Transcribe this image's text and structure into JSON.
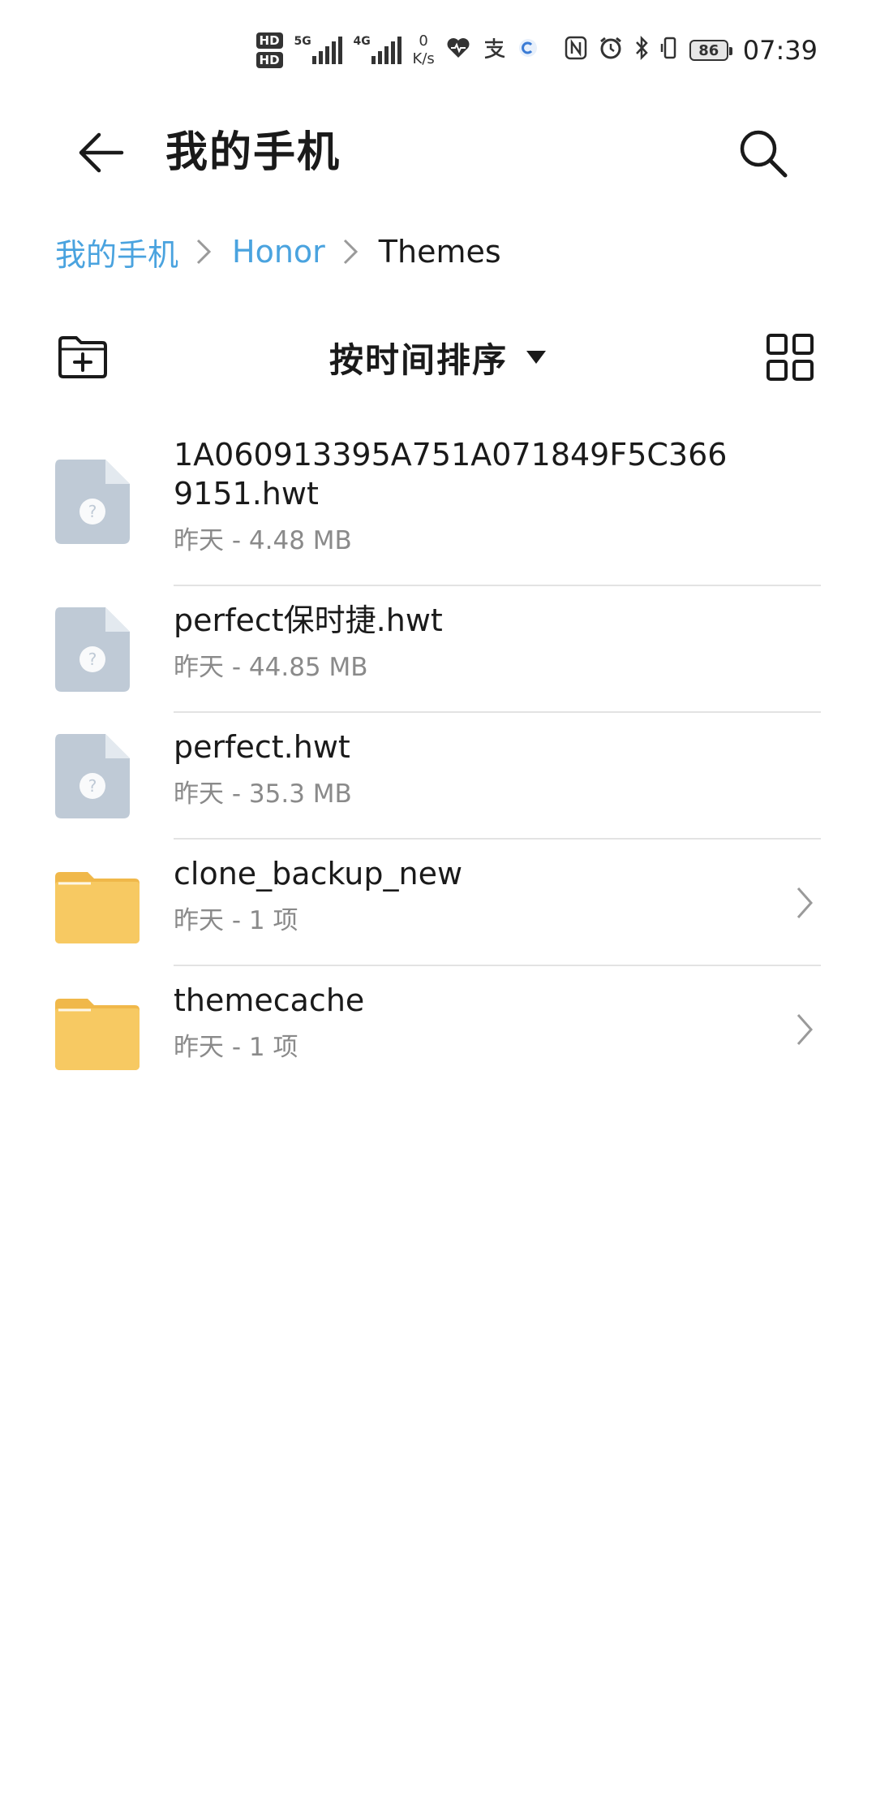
{
  "status_bar": {
    "hd1": "HD",
    "hd2": "HD",
    "net1": "5G",
    "net2": "4G",
    "speed_value": "0",
    "speed_unit": "K/s",
    "battery": "86",
    "time": "07:39",
    "icons": [
      "heart-health-icon",
      "alipay-icon",
      "app-c-icon",
      "nfc-icon",
      "alarm-icon",
      "bluetooth-icon",
      "vibrate-icon"
    ]
  },
  "header": {
    "title": "我的手机"
  },
  "breadcrumb": {
    "items": [
      "我的手机",
      "Honor",
      "Themes"
    ]
  },
  "toolbar": {
    "sort_label": "按时间排序"
  },
  "files": [
    {
      "type": "unknown-file",
      "name": "1A060913395A751A071849F5C3669151.hwt",
      "meta": "昨天 - 4.48 MB"
    },
    {
      "type": "unknown-file",
      "name": "perfect保时捷.hwt",
      "meta": "昨天 - 44.85 MB"
    },
    {
      "type": "unknown-file",
      "name": "perfect.hwt",
      "meta": "昨天 - 35.3 MB"
    },
    {
      "type": "folder",
      "name": "clone_backup_new",
      "meta": "昨天 - 1 项"
    },
    {
      "type": "folder",
      "name": "themecache",
      "meta": "昨天 - 1 项"
    }
  ],
  "colors": {
    "accent": "#4aa3df",
    "folder": "#f7c962",
    "unknown_file": "#bfcad6",
    "divider": "#e3e3e3",
    "meta_text": "#8a8a8a"
  }
}
